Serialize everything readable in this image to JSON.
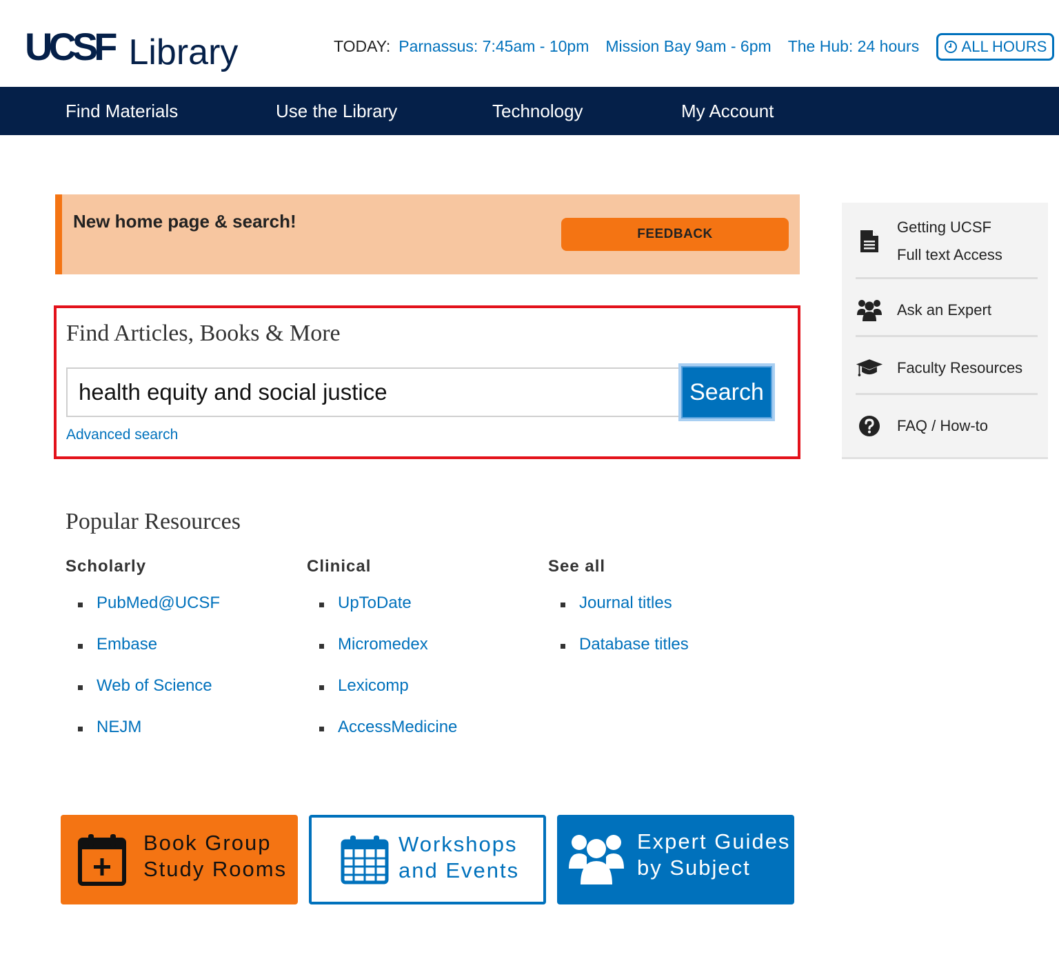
{
  "header": {
    "logo_ucsf": "UCSF",
    "logo_library": "Library",
    "today_label": "TODAY:",
    "hours": [
      "Parnassus: 7:45am - 10pm",
      "Mission Bay 9am - 6pm",
      "The Hub: 24 hours"
    ],
    "all_hours_label": "ALL HOURS"
  },
  "nav": {
    "items": [
      "Find Materials",
      "Use the Library",
      "Technology",
      "My Account"
    ]
  },
  "banner": {
    "text": "New home page & search!",
    "button_label": "FEEDBACK"
  },
  "search": {
    "title": "Find Articles, Books & More",
    "value": "health equity and social justice",
    "button_label": "Search",
    "advanced_label": "Advanced search"
  },
  "sidebar": {
    "items": [
      {
        "label_line1": "Getting UCSF",
        "label_line2": "Full text Access",
        "icon": "document-icon"
      },
      {
        "label": "Ask an Expert",
        "icon": "users-icon"
      },
      {
        "label": "Faculty Resources",
        "icon": "graduation-cap-icon"
      },
      {
        "label": "FAQ / How-to",
        "icon": "question-circle-icon"
      }
    ]
  },
  "popular": {
    "title": "Popular Resources",
    "columns": [
      {
        "heading": "Scholarly",
        "links": [
          "PubMed@UCSF",
          "Embase",
          "Web of Science",
          "NEJM"
        ]
      },
      {
        "heading": "Clinical",
        "links": [
          "UpToDate",
          "Micromedex",
          "Lexicomp",
          "AccessMedicine"
        ]
      },
      {
        "heading": "See all",
        "links": [
          "Journal titles",
          "Database titles"
        ]
      }
    ]
  },
  "tiles": [
    {
      "line1": "Book Group",
      "line2": "Study Rooms",
      "icon": "calendar-plus-icon",
      "color": "#f47413"
    },
    {
      "line1": "Workshops",
      "line2": "and Events",
      "icon": "calendar-icon",
      "color": "#ffffff"
    },
    {
      "line1": "Expert Guides",
      "line2": "by Subject",
      "icon": "users-icon",
      "color": "#0071bc"
    }
  ],
  "colors": {
    "navy": "#052049",
    "link_blue": "#0071bc",
    "orange": "#f47413",
    "banner_bg": "#f7c6a0",
    "highlight_red": "#e3121b"
  }
}
